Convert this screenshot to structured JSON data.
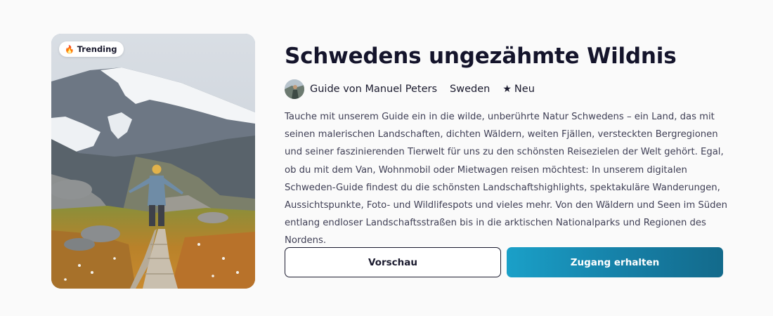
{
  "card": {
    "image_alt": "Hiker on wooden boardwalk in Swedish mountain landscape",
    "badge": {
      "icon": "flame-icon",
      "label": "Trending"
    }
  },
  "guide": {
    "title": "Schwedens ungezähmte Wildnis",
    "author": "Guide von Manuel Peters",
    "country": "Sweden",
    "tag_icon": "★",
    "tag": "Neu",
    "description": "Tauche mit unserem Guide ein in die wilde, unberührte Natur Schwedens – ein Land, das mit seinen malerischen Landschaften, dichten Wäldern, weiten Fjällen, versteckten Bergregionen und seiner faszinierenden Tierwelt für uns zu den schönsten Reisezielen der Welt gehört. Egal, ob du mit dem Van, Wohnmobil oder Mietwagen reisen möchtest: In unserem digitalen Schweden-Guide findest du die schönsten Landschaftshighlights, spektakuläre Wanderungen, Aussichtspunkte, Foto- und Wildlifespots und vieles mehr. Von den Wäldern und Seen im Süden entlang endloser Landschaftsstraßen bis in die arktischen Nationalparks und Regionen des Nordens."
  },
  "actions": {
    "preview_label": "Vorschau",
    "access_label": "Zugang erhalten"
  },
  "colors": {
    "primary_start": "#1aa0c8",
    "primary_end": "#136a8b",
    "badge_flame": "#f08a24",
    "title": "#14142b"
  }
}
